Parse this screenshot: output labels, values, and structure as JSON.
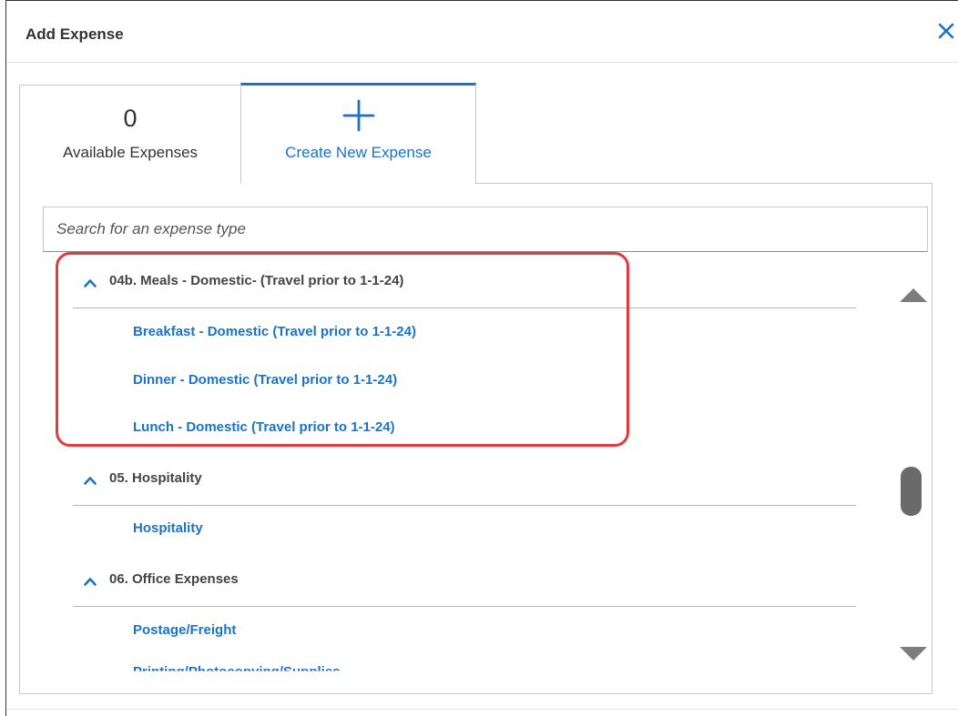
{
  "dialog": {
    "title": "Add Expense",
    "close_icon": "close-icon"
  },
  "tabs": {
    "available": {
      "count": "0",
      "label": "Available Expenses"
    },
    "create": {
      "icon": "plus-icon",
      "label": "Create New Expense",
      "active": true
    }
  },
  "search": {
    "value": "",
    "placeholder": "Search for an expense type"
  },
  "groups": [
    {
      "label": "04b. Meals - Domestic- (Travel prior to 1-1-24)",
      "items": [
        "Breakfast - Domestic (Travel prior to 1-1-24)",
        "Dinner - Domestic (Travel prior to 1-1-24)",
        "Lunch - Domestic (Travel prior to 1-1-24)"
      ]
    },
    {
      "label": "05. Hospitality",
      "items": [
        "Hospitality"
      ]
    },
    {
      "label": "06. Office Expenses",
      "items": [
        "Postage/Freight",
        "Printing/Photocopying/Supplies"
      ]
    }
  ],
  "colors": {
    "accent": "#1a73c8",
    "highlight": "#e5393e",
    "text": "#333333",
    "border": "#c8c8c8"
  }
}
